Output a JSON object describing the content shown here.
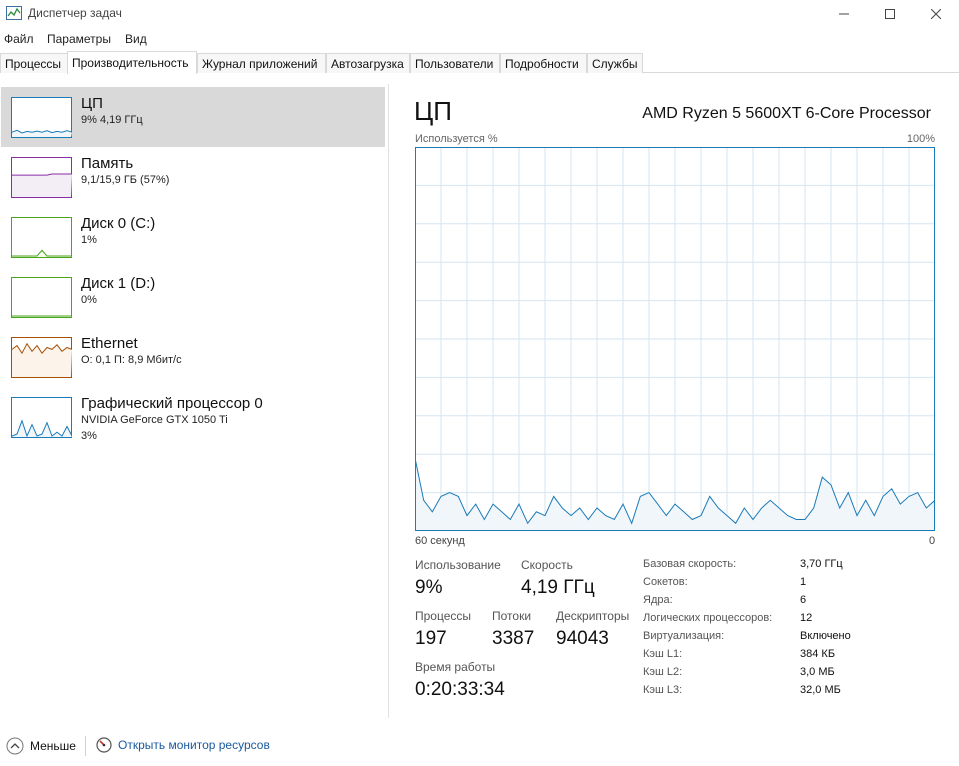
{
  "window": {
    "title": "Диспетчер задач"
  },
  "menu": [
    "Файл",
    "Параметры",
    "Вид"
  ],
  "tabs": [
    "Процессы",
    "Производительность",
    "Журнал приложений",
    "Автозагрузка",
    "Пользователи",
    "Подробности",
    "Службы"
  ],
  "active_tab": "Производительность",
  "sidebar": {
    "items": [
      {
        "title": "ЦП",
        "line1": "9% 4,19 ГГц",
        "line2": "",
        "color": "#1a7bb8",
        "fill": "#f1f6fb"
      },
      {
        "title": "Память",
        "line1": "9,1/15,9 ГБ (57%)",
        "line2": "",
        "color": "#8b2ba6",
        "fill": "#f3eef5"
      },
      {
        "title": "Диск 0 (C:)",
        "line1": "1%",
        "line2": "",
        "color": "#4aa51c",
        "fill": "#f3faef"
      },
      {
        "title": "Диск 1 (D:)",
        "line1": "0%",
        "line2": "",
        "color": "#4aa51c",
        "fill": "#f3faef"
      },
      {
        "title": "Ethernet",
        "line1": "О: 0,1 П: 8,9 Мбит/с",
        "line2": "",
        "color": "#a74f01",
        "fill": "#fcf3eb"
      },
      {
        "title": "Графический процессор 0",
        "line1": "NVIDIA GeForce GTX 1050 Ti",
        "line2": "3%",
        "color": "#1a7bb8",
        "fill": "#f1f6fb"
      }
    ]
  },
  "main": {
    "title": "ЦП",
    "cpu_model": "AMD Ryzen 5 5600XT 6-Core Processor",
    "graph_label_left": "Используется %",
    "graph_label_right": "100%",
    "graph_bottom_left": "60 секунд",
    "graph_bottom_right": "0",
    "graph_color": "#1a7bb8",
    "utilization_percent": [
      19,
      8,
      5,
      9,
      10,
      9,
      4,
      7,
      3,
      7,
      5,
      3,
      7,
      2,
      5,
      4,
      9,
      6,
      4,
      6,
      3,
      6,
      4,
      3,
      7,
      2,
      9,
      10,
      7,
      4,
      7,
      5,
      3,
      4,
      9,
      6,
      4,
      2,
      6,
      3,
      6,
      8,
      6,
      4,
      3,
      3,
      6,
      14,
      12,
      6,
      10,
      4,
      8,
      4,
      9,
      11,
      7,
      9,
      10,
      6,
      8
    ],
    "stats": {
      "usage_label": "Использование",
      "usage_value": "9%",
      "speed_label": "Скорость",
      "speed_value": "4,19 ГГц",
      "processes_label": "Процессы",
      "processes_value": "197",
      "threads_label": "Потоки",
      "threads_value": "3387",
      "handles_label": "Дескрипторы",
      "handles_value": "94043",
      "uptime_label": "Время работы",
      "uptime_value": "0:20:33:34"
    },
    "specs": [
      {
        "label": "Базовая скорость:",
        "value": "3,70 ГГц"
      },
      {
        "label": "Сокетов:",
        "value": "1"
      },
      {
        "label": "Ядра:",
        "value": "6"
      },
      {
        "label": "Логических процессоров:",
        "value": "12"
      },
      {
        "label": "Виртуализация:",
        "value": "Включено"
      },
      {
        "label": "Кэш L1:",
        "value": "384 КБ"
      },
      {
        "label": "Кэш L2:",
        "value": "3,0 МБ"
      },
      {
        "label": "Кэш L3:",
        "value": "32,0 МБ"
      }
    ]
  },
  "footer": {
    "less_label": "Меньше",
    "monitor_label": "Открыть монитор ресурсов"
  }
}
